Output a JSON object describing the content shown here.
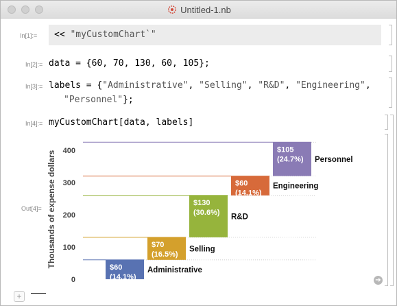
{
  "window": {
    "title": "Untitled-1.nb"
  },
  "cells": {
    "in1": {
      "label": "In[1]:=",
      "code_prefix": "<< ",
      "code_string": "\"myCustomChart`\""
    },
    "in2": {
      "label": "In[2]:=",
      "code": "data = {60, 70, 130, 60, 105};"
    },
    "in3": {
      "label": "In[3]:=",
      "line1_prefix": "labels = {",
      "s1": "\"Administrative\"",
      "s2": "\"Selling\"",
      "s3": "\"R&D\"",
      "s4": "\"Engineering\"",
      "line1_suffix": ",",
      "s5": "\"Personnel\"",
      "line2_suffix": "};"
    },
    "in4": {
      "label": "In[4]:=",
      "code": "myCustomChart[data, labels]"
    },
    "out4": {
      "label": "Out[4]="
    }
  },
  "chart_data": {
    "type": "bar",
    "subtype": "waterfall",
    "ylabel": "Thousands of expense dollars",
    "ylim": [
      0,
      425
    ],
    "yticks": [
      0,
      100,
      200,
      300,
      400
    ],
    "grid": "horizontal reference lines at cumulative totals",
    "categories": [
      "Administrative",
      "Selling",
      "R&D",
      "Engineering",
      "Personnel"
    ],
    "values": [
      60,
      70,
      130,
      60,
      105
    ],
    "value_labels": [
      "$60",
      "$70",
      "$130",
      "$60",
      "$105"
    ],
    "percent_labels": [
      "(14.1%)",
      "(16.5%)",
      "(30.6%)",
      "(14.1%)",
      "(24.7%)"
    ],
    "colors": [
      "#5872b2",
      "#d4a02c",
      "#96b43c",
      "#d76a3a",
      "#8a7bb5"
    ]
  }
}
